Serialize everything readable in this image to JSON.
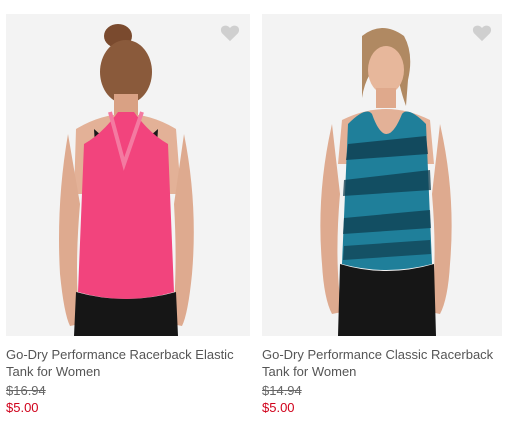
{
  "products": [
    {
      "title": "Go-Dry Performance Racerback Elastic Tank for Women",
      "was_price": "$16.94",
      "sale_price": "$5.00",
      "image_desc": "model-back-pink-tank"
    },
    {
      "title": "Go-Dry Performance Classic Racerback Tank for Women",
      "was_price": "$14.94",
      "sale_price": "$5.00",
      "image_desc": "model-front-teal-camo-tank"
    }
  ],
  "colors": {
    "sale_price": "#d0021b",
    "heart": "#cfcfcf",
    "pink_tank": "#f2447d",
    "teal_tank": "#1f7f9a"
  },
  "icons": {
    "favorite": "heart-icon"
  }
}
